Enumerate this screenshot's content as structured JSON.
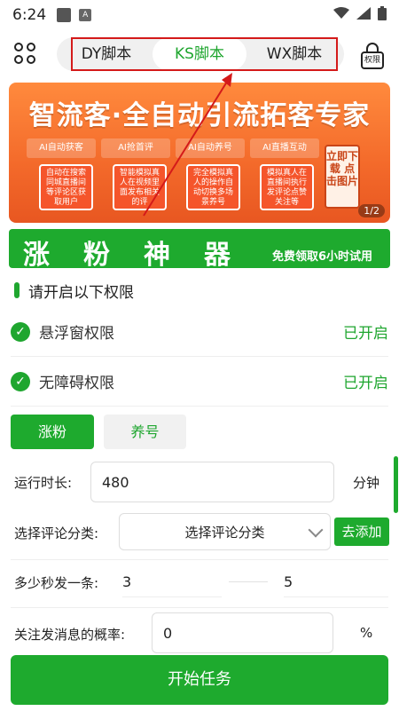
{
  "status_bar": {
    "time": "6:24",
    "notif_letter": "A",
    "icons": [
      "notification-square-icon",
      "a-badge-icon",
      "wifi-icon",
      "signal-icon",
      "battery-icon"
    ]
  },
  "app_bar": {
    "tabs": [
      {
        "label": "DY脚本",
        "active": false
      },
      {
        "label": "KS脚本",
        "active": true
      },
      {
        "label": "WX脚本",
        "active": false
      }
    ],
    "lock_label": "权限"
  },
  "banner": {
    "headline": "智流客·全自动引流拓客专家",
    "features": [
      "AI自动获客",
      "AI抢首评",
      "AI自动养号",
      "AI直播互动"
    ],
    "cards": [
      "自动在搜索同城直播间等评论区获取用户",
      "智能模拟真人在视频里面发布相关的评",
      "完全模拟真人的操作自动切换多场景养号",
      "模拟真人在直播间执行发评论点赞关注等"
    ],
    "tap_label": "立即下载 点击图片",
    "pager": "1/2"
  },
  "promo": {
    "title": "涨粉神器",
    "subtitle": "免费领取6小时试用"
  },
  "permissions": {
    "heading": "请开启以下权限",
    "items": [
      {
        "label": "悬浮窗权限",
        "state": "已开启"
      },
      {
        "label": "无障碍权限",
        "state": "已开启"
      }
    ]
  },
  "mode_tabs": {
    "primary": "涨粉",
    "secondary": "养号"
  },
  "form": {
    "runtime_label": "运行时长:",
    "runtime_value": "480",
    "runtime_unit": "分钟",
    "category_label": "选择评论分类:",
    "category_value": "选择评论分类",
    "add_label": "去添加",
    "interval_label": "多少秒发一条:",
    "interval_min": "3",
    "interval_max": "5",
    "follow_label": "关注发消息的概率:",
    "follow_value": "0",
    "follow_unit": "%",
    "start_label": "开始任务"
  },
  "colors": {
    "accent": "#1eaa2e",
    "banner": "#f3692a",
    "annotation": "#d41a1a"
  }
}
